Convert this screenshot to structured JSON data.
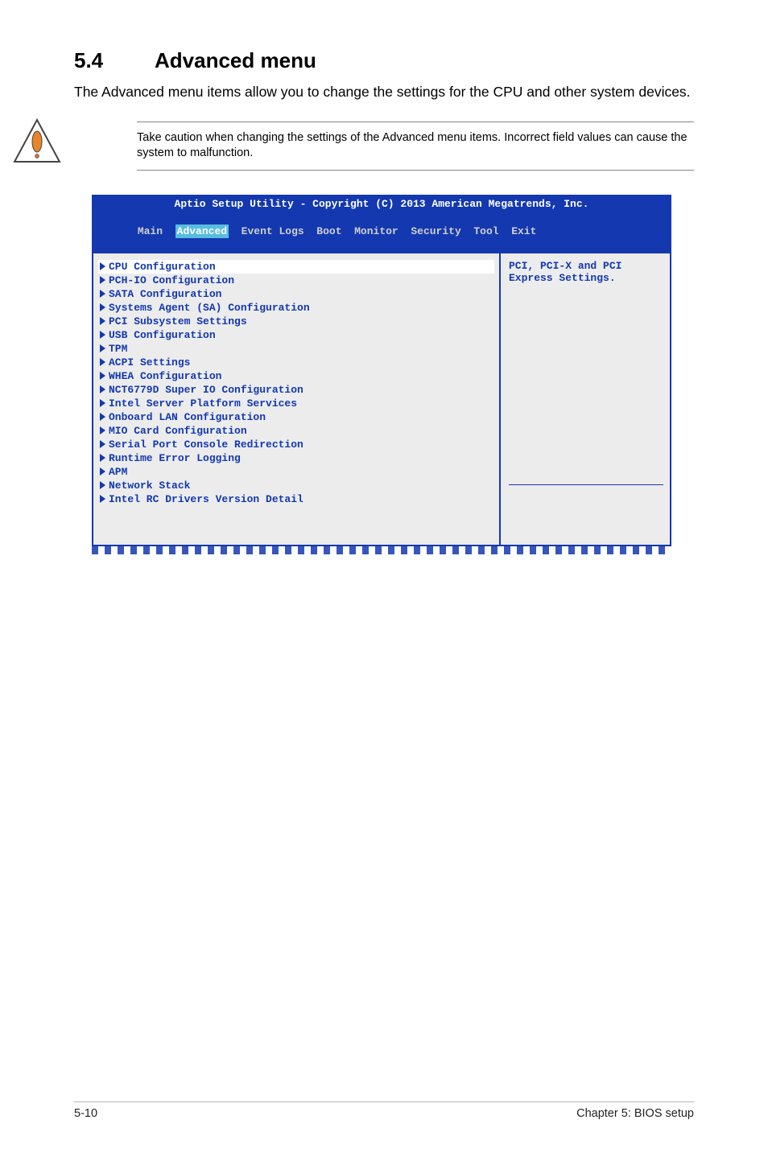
{
  "heading": {
    "number": "5.4",
    "title": "Advanced menu"
  },
  "intro": "The Advanced menu items allow you to change the settings for the CPU and other system devices.",
  "warning": "Take caution when changing the settings of the Advanced menu items. Incorrect field values can cause the system to malfunction.",
  "bios": {
    "title": "Aptio Setup Utility - Copyright (C) 2013 American Megatrends, Inc.",
    "tabs": [
      "Main",
      "Advanced",
      "Event Logs",
      "Boot",
      "Monitor",
      "Security",
      "Tool",
      "Exit"
    ],
    "selected_tab": "Advanced",
    "help_line1": "PCI, PCI-X and PCI",
    "help_line2": "Express Settings.",
    "items": [
      "CPU Configuration",
      "PCH-IO Configuration",
      "SATA Configuration",
      "Systems Agent (SA) Configuration",
      "PCI Subsystem Settings",
      "USB Configuration",
      "TPM",
      "ACPI Settings",
      "WHEA Configuration",
      "NCT6779D Super IO Configuration",
      "Intel Server Platform Services",
      "Onboard LAN Configuration",
      "MIO Card Configuration",
      "Serial Port Console Redirection",
      "Runtime Error Logging",
      "APM",
      "Network Stack",
      "Intel RC Drivers Version Detail"
    ],
    "selected_item_index": 0
  },
  "footer": {
    "left": "5-10",
    "right": "Chapter 5: BIOS setup"
  }
}
